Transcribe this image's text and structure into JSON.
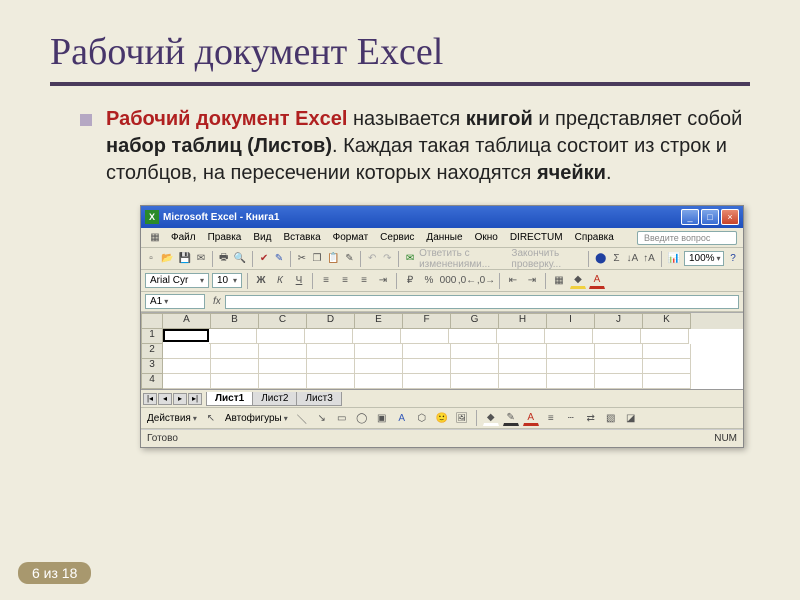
{
  "slide": {
    "title": "Рабочий документ Excel",
    "text_parts": {
      "p1": "Рабочий документ Excel",
      "p2": " называется ",
      "p3": "книгой",
      "p4": " и представляет собой ",
      "p5": "набор таблиц (Листов)",
      "p6": ". Каждая такая таблица состоит из строк и столбцов, на пересечении которых находятся ",
      "p7": "ячейки",
      "p8": "."
    },
    "page_indicator": "6 из 18"
  },
  "excel": {
    "titlebar": {
      "app_icon": "X",
      "title": "Microsoft Excel - Книга1"
    },
    "menu": [
      "Файл",
      "Правка",
      "Вид",
      "Вставка",
      "Формат",
      "Сервис",
      "Данные",
      "Окно",
      "DIRECTUM",
      "Справка"
    ],
    "question_placeholder": "Введите вопрос",
    "toolbar1_extra": {
      "review_label": "Ответить с изменениями...",
      "check_label": "Закончить проверку...",
      "zoom": "100%"
    },
    "format": {
      "font": "Arial Cyr",
      "size": "10"
    },
    "namebox": "A1",
    "fx": "fx",
    "columns": [
      "A",
      "B",
      "C",
      "D",
      "E",
      "F",
      "G",
      "H",
      "I",
      "J",
      "K"
    ],
    "rows": [
      "1",
      "2",
      "3",
      "4"
    ],
    "sheets": [
      "Лист1",
      "Лист2",
      "Лист3"
    ],
    "draw": {
      "actions": "Действия",
      "autoshapes": "Автофигуры"
    },
    "status": {
      "ready": "Готово",
      "num": "NUM"
    }
  }
}
